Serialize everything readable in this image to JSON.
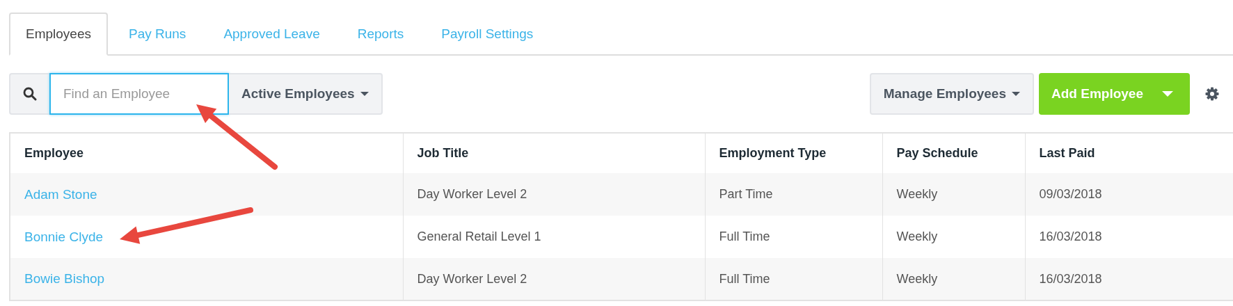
{
  "tabs": [
    {
      "label": "Employees",
      "selected": true
    },
    {
      "label": "Pay Runs",
      "selected": false
    },
    {
      "label": "Approved Leave",
      "selected": false
    },
    {
      "label": "Reports",
      "selected": false
    },
    {
      "label": "Payroll Settings",
      "selected": false
    }
  ],
  "search": {
    "placeholder": "Find an Employee"
  },
  "filter": {
    "label": "Active Employees"
  },
  "manage": {
    "label": "Manage Employees"
  },
  "add": {
    "label": "Add Employee"
  },
  "table": {
    "columns": [
      "Employee",
      "Job Title",
      "Employment Type",
      "Pay Schedule",
      "Last Paid"
    ],
    "rows": [
      [
        "Adam Stone",
        "Day Worker Level 2",
        "Part Time",
        "Weekly",
        "09/03/2018"
      ],
      [
        "Bonnie Clyde",
        "General Retail Level 1",
        "Full Time",
        "Weekly",
        "16/03/2018"
      ],
      [
        "Bowie Bishop",
        "Day Worker Level 2",
        "Full Time",
        "Weekly",
        "16/03/2018"
      ]
    ]
  },
  "annotations": [
    {
      "kind": "arrow"
    },
    {
      "kind": "arrow"
    }
  ]
}
